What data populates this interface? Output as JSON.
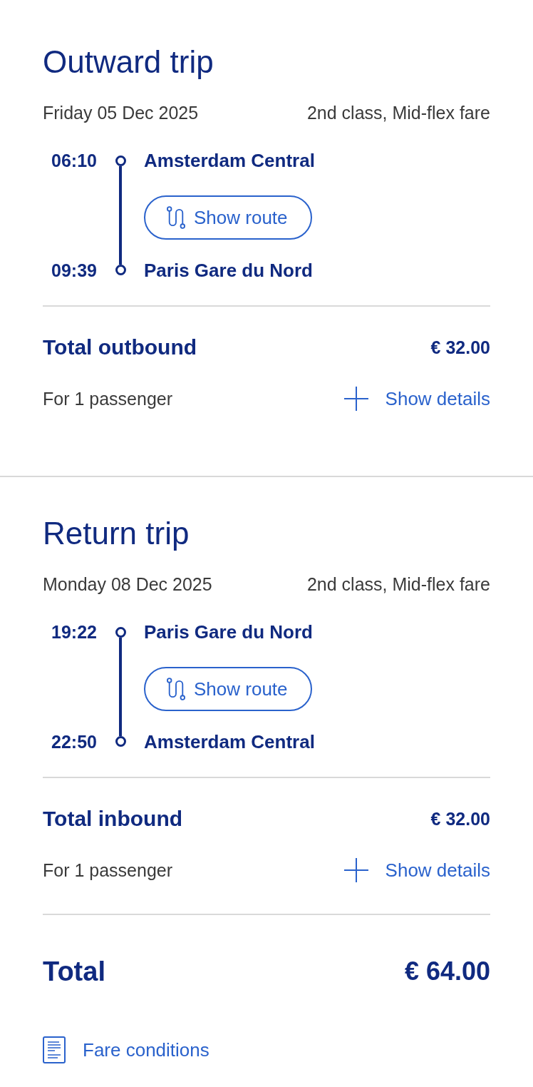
{
  "trips": [
    {
      "title": "Outward trip",
      "date": "Friday 05 Dec 2025",
      "fare": "2nd class, Mid-flex fare",
      "departure": {
        "time": "06:10",
        "station": "Amsterdam Central"
      },
      "route_button": "Show route",
      "arrival": {
        "time": "09:39",
        "station": "Paris Gare du Nord"
      },
      "total_label": "Total outbound",
      "total_price": "€ 32.00",
      "passengers": "For 1 passenger",
      "details_button": "Show details"
    },
    {
      "title": "Return trip",
      "date": "Monday 08 Dec 2025",
      "fare": "2nd class, Mid-flex fare",
      "departure": {
        "time": "19:22",
        "station": "Paris Gare du Nord"
      },
      "route_button": "Show route",
      "arrival": {
        "time": "22:50",
        "station": "Amsterdam Central"
      },
      "total_label": "Total inbound",
      "total_price": "€ 32.00",
      "passengers": "For 1 passenger",
      "details_button": "Show details"
    }
  ],
  "total": {
    "label": "Total",
    "price": "€ 64.00"
  },
  "fare_conditions_link": "Fare conditions"
}
